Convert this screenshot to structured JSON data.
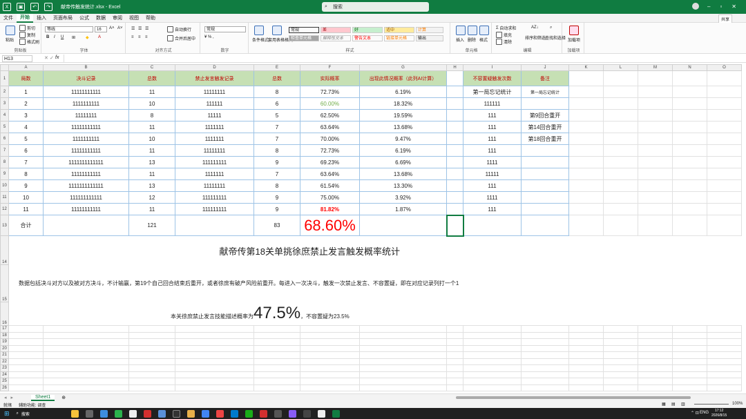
{
  "window": {
    "title": "献帝传触发统计.xlsx - Excel",
    "search": "搜索",
    "share": "共享"
  },
  "tabs": [
    "文件",
    "开始",
    "插入",
    "页面布局",
    "公式",
    "数据",
    "审阅",
    "视图",
    "帮助"
  ],
  "ribbon": {
    "clipboard": {
      "paste": "粘贴",
      "cut": "剪切",
      "copy": "复制",
      "painter": "格式刷",
      "label": "剪贴板"
    },
    "font": {
      "name": "等线",
      "size": "16",
      "label": "字体"
    },
    "align": {
      "wrap": "自动换行",
      "merge": "合并后居中",
      "label": "对齐方式"
    },
    "number": {
      "format": "常规",
      "label": "数字"
    },
    "styles": {
      "cond": "条件格式",
      "table": "套用表格格式",
      "s1": "常规",
      "s2": "差",
      "s3": "好",
      "s4": "适中",
      "s5": "计算",
      "s6": "检查单元格",
      "s7": "解释性文本",
      "s8": "警告文本",
      "s9": "链接单元格",
      "s10": "输出",
      "label": "样式"
    },
    "cells": {
      "insert": "插入",
      "delete": "删除",
      "format": "格式",
      "label": "单元格"
    },
    "edit": {
      "autosum": "自动求和",
      "fill": "填充",
      "clear": "清除",
      "sort": "排序和筛选",
      "find": "查找和选择",
      "label": "编辑"
    },
    "addins": {
      "a": "加载项",
      "label": "加载项"
    }
  },
  "formula": {
    "cell": "H13",
    "fx": "fx"
  },
  "columns": [
    "A",
    "B",
    "C",
    "D",
    "E",
    "F",
    "G",
    "H",
    "I",
    "J",
    "K",
    "L",
    "M",
    "N",
    "O"
  ],
  "headers": [
    "局数",
    "决斗记录",
    "总数",
    "禁止发言触发记录",
    "总数",
    "实际概率",
    "出现此情况概率（此列AI计算）",
    "",
    "不容置疑触发次数",
    "备注"
  ],
  "rows": [
    [
      "1",
      "11111111111",
      "11",
      "11111111",
      "8",
      "72.73%",
      "6.19%",
      "",
      "第一局忘记统计",
      "第一局忘记统计"
    ],
    [
      "2",
      "1111111111",
      "10",
      "111111",
      "6",
      "60.00%",
      "18.32%",
      "",
      "111111",
      ""
    ],
    [
      "3",
      "11111111",
      "8",
      "11111",
      "5",
      "62.50%",
      "19.59%",
      "",
      "111",
      "第9回合重开"
    ],
    [
      "4",
      "11111111111",
      "11",
      "1111111",
      "7",
      "63.64%",
      "13.68%",
      "",
      "111",
      "第14回合重开"
    ],
    [
      "5",
      "1111111111",
      "10",
      "1111111",
      "7",
      "70.00%",
      "9.47%",
      "",
      "111",
      "第18回合重开"
    ],
    [
      "6",
      "11111111111",
      "11",
      "11111111",
      "8",
      "72.73%",
      "6.19%",
      "",
      "111",
      ""
    ],
    [
      "7",
      "1111111111111",
      "13",
      "111111111",
      "9",
      "69.23%",
      "6.69%",
      "",
      "1111",
      ""
    ],
    [
      "8",
      "11111111111",
      "11",
      "1111111",
      "7",
      "63.64%",
      "13.68%",
      "",
      "11111",
      ""
    ],
    [
      "9",
      "1111111111111",
      "13",
      "11111111",
      "8",
      "61.54%",
      "13.30%",
      "",
      "111",
      ""
    ],
    [
      "10",
      "111111111111",
      "12",
      "111111111",
      "9",
      "75.00%",
      "3.92%",
      "",
      "1111",
      ""
    ],
    [
      "11",
      "11111111111",
      "11",
      "111111111",
      "9",
      "81.82%",
      "1.87%",
      "",
      "111",
      ""
    ]
  ],
  "total": {
    "label": "合计",
    "sum": "121",
    "trig": "83",
    "rate": "68.60%"
  },
  "notes": {
    "title": "献帝传第18关单挑徐庶禁止发言触发概率统计",
    "desc": "数据包括决斗对方以及被对方决斗，不计输赢，第19个自己回合结束后重开，或者徐庶有破产风险前重开。每进入一次决斗，触发一次禁止发言、不容置疑，即在对应记录列打一个1",
    "r16a": "本关徐庶禁止发言技能描述概率为",
    "r16big": "47.5%",
    "r16b": "，不容置疑为23.5%"
  },
  "sheet": "Sheet1",
  "status": {
    "ready": "就绪",
    "access": "辅助功能: 调查",
    "zoom": "100%"
  },
  "taskbar": {
    "search": "搜索",
    "time": "17:12",
    "date": "2026/8/15",
    "lang": "ENG"
  }
}
